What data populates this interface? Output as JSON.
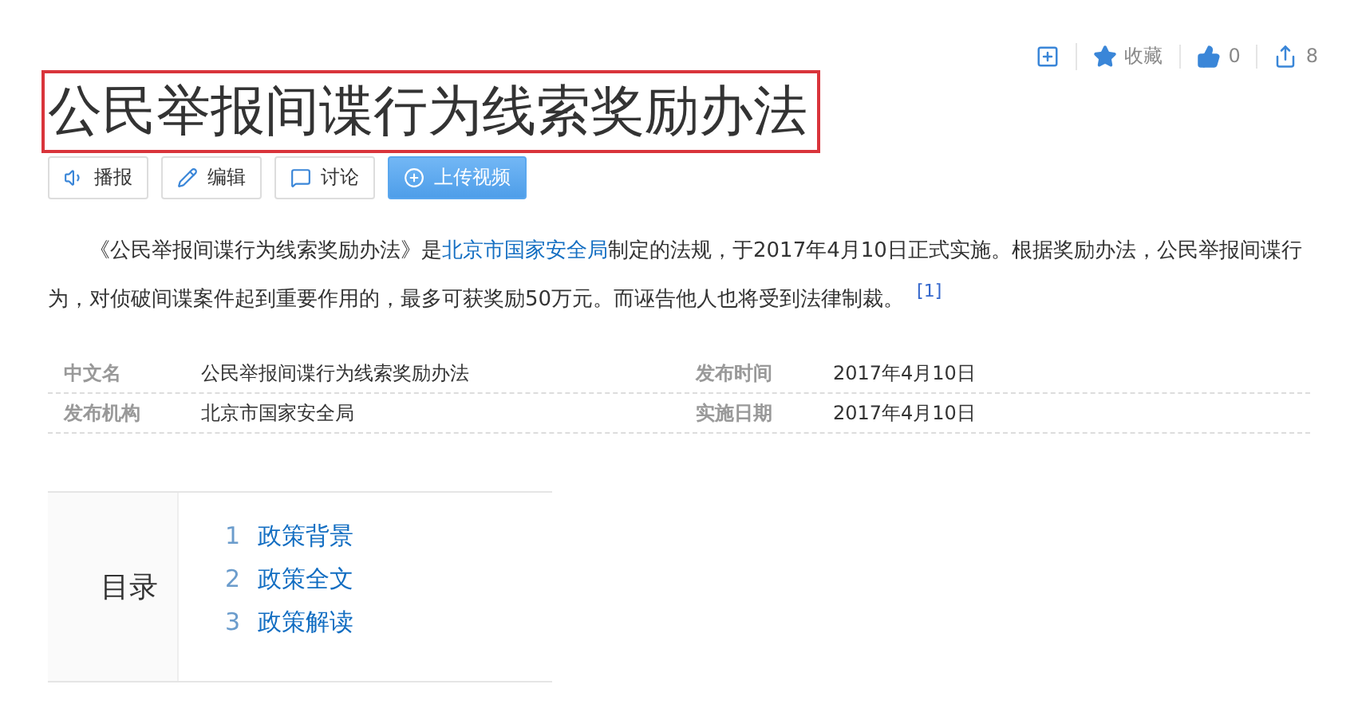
{
  "actions": [
    {
      "kind": "add"
    },
    {
      "kind": "star",
      "label": "收藏"
    },
    {
      "kind": "like",
      "label": "0"
    },
    {
      "kind": "share",
      "label": "8"
    }
  ],
  "title": "公民举报间谍行为线索奖励办法",
  "toolbar": [
    {
      "kind": "speaker",
      "label": "播报",
      "primary": false
    },
    {
      "kind": "pencil",
      "label": "编辑",
      "primary": false
    },
    {
      "kind": "comment",
      "label": "讨论",
      "primary": false
    },
    {
      "kind": "plus",
      "label": "上传视频",
      "primary": true
    }
  ],
  "intro": {
    "before": "《公民举报间谍行为线索奖励办法》是",
    "link": "北京市国家安全局",
    "after": "制定的法规，于2017年4月10日正式实施。根据奖励办法，公民举报间谍行为，对侦破间谍案件起到重要作用的，最多可获奖励50万元。而诬告他人也将受到法律制裁。",
    "citation": "[1]"
  },
  "info": [
    [
      {
        "name": "中文名",
        "value": "公民举报间谍行为线索奖励办法"
      },
      {
        "name": "发布时间",
        "value": "2017年4月10日"
      }
    ],
    [
      {
        "name": "发布机构",
        "value": "北京市国家安全局"
      },
      {
        "name": "实施日期",
        "value": "2017年4月10日"
      }
    ]
  ],
  "toc": {
    "heading": "目录",
    "items": [
      {
        "number": "1",
        "label": "政策背景"
      },
      {
        "number": "2",
        "label": "政策全文"
      },
      {
        "number": "3",
        "label": "政策解读"
      }
    ]
  }
}
